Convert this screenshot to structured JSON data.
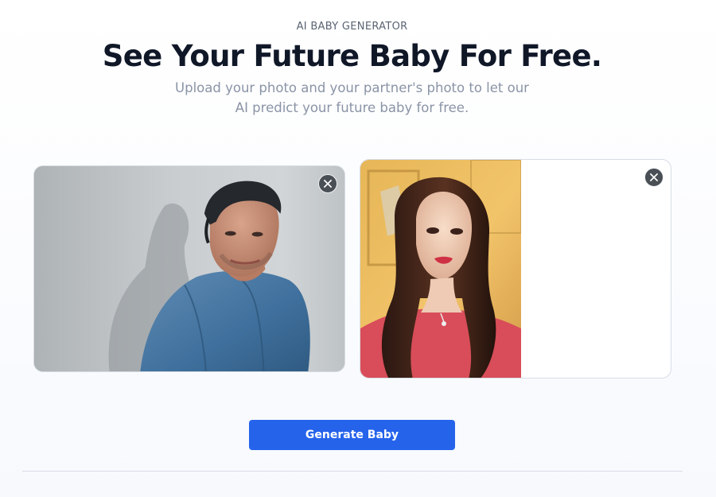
{
  "header": {
    "eyebrow": "AI BABY GENERATOR",
    "title": "See Your Future Baby For Free.",
    "subtitle": "Upload your photo and your partner's photo to let our AI predict your future baby for free."
  },
  "uploads": [
    {
      "remove_icon": "close-icon"
    },
    {
      "remove_icon": "close-icon"
    }
  ],
  "actions": {
    "generate_label": "Generate Baby"
  },
  "colors": {
    "primary": "#2563eb",
    "heading": "#101828",
    "muted": "#8a94a6"
  }
}
